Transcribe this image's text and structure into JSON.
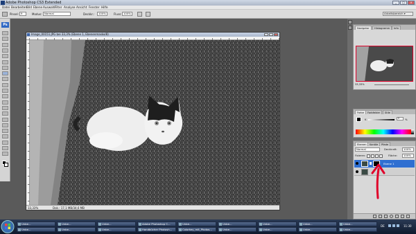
{
  "app": {
    "title": "Adobe Photoshop CS3 Extended",
    "window_buttons": [
      "_",
      "□",
      "×"
    ]
  },
  "menu": [
    "Datei",
    "Bearbeiten",
    "Bild",
    "Ebene",
    "Auswahl",
    "Filter",
    "Analyse",
    "Ansicht",
    "Fenster",
    "Hilfe"
  ],
  "options": {
    "pinsel_label": "Pinsel:",
    "pinsel_value": "9",
    "modus_label": "Modus:",
    "modus_value": "Normal",
    "deckkraft_label": "Deckkr.:",
    "deckkraft_value": "100%",
    "fluss_label": "Fluss:",
    "fluss_value": "100%",
    "arbeitsbereich": "Arbeitsbereich ▾"
  },
  "document": {
    "title": "Image_00151.JPG bei 33,3% (Ebene 1, Ebenenmaske/8)",
    "zoom": "33,33%",
    "doc_info": "Dok.: 17,1 MB/34,6 MB"
  },
  "navigator_panel": {
    "tabs": [
      "Navigator",
      "Histogramm",
      "Info"
    ],
    "zoom": "33,33%"
  },
  "color_panel": {
    "tabs": [
      "Farbe",
      "Farbfelder",
      "Stile"
    ],
    "channel": "K",
    "value": "0",
    "percent": "%"
  },
  "layers_panel": {
    "tabs": [
      "Ebenen",
      "Kanäle",
      "Pfade"
    ],
    "mode": "Normal",
    "deckkraft_label": "Deckkraft:",
    "deckkraft_value": "100%",
    "fixieren_label": "Fixieren:",
    "flaeche_label": "Fläche:",
    "flaeche_value": "100%",
    "layers": [
      {
        "name": "Ebene 1",
        "selected": true
      },
      {
        "name": "",
        "selected": false
      }
    ]
  },
  "taskbar": {
    "row1": [
      "Unbe...",
      "Unbe...",
      "Unbe...",
      "Adobe Photoshop C...",
      "Unbe...",
      "Unbe...",
      "Unbe...",
      "Unbe...",
      "Unbe..."
    ],
    "row2": [
      "Unbe...",
      "Unbe...",
      "Unbe...",
      "Handbücher Photosh...",
      "Colorkey_mit_Photos...",
      "Unbe...",
      "Unbe...",
      "Unbe...",
      "Unbe..."
    ],
    "clock": "11:30",
    "lang": "DE"
  },
  "colors": {
    "accent_selected": "#2f6fd1",
    "arrow": "#e0002a",
    "brand": "#1b3d78"
  }
}
